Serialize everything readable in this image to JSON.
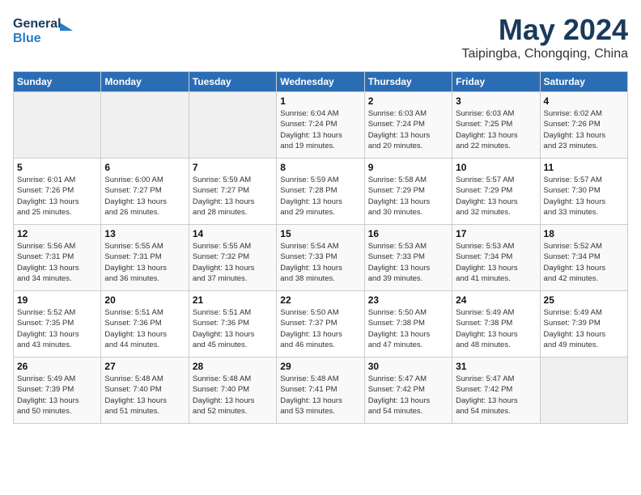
{
  "header": {
    "logo_line1": "General",
    "logo_line2": "Blue",
    "month_year": "May 2024",
    "location": "Taipingba, Chongqing, China"
  },
  "weekdays": [
    "Sunday",
    "Monday",
    "Tuesday",
    "Wednesday",
    "Thursday",
    "Friday",
    "Saturday"
  ],
  "weeks": [
    [
      {
        "day": "",
        "info": ""
      },
      {
        "day": "",
        "info": ""
      },
      {
        "day": "",
        "info": ""
      },
      {
        "day": "1",
        "info": "Sunrise: 6:04 AM\nSunset: 7:24 PM\nDaylight: 13 hours\nand 19 minutes."
      },
      {
        "day": "2",
        "info": "Sunrise: 6:03 AM\nSunset: 7:24 PM\nDaylight: 13 hours\nand 20 minutes."
      },
      {
        "day": "3",
        "info": "Sunrise: 6:03 AM\nSunset: 7:25 PM\nDaylight: 13 hours\nand 22 minutes."
      },
      {
        "day": "4",
        "info": "Sunrise: 6:02 AM\nSunset: 7:26 PM\nDaylight: 13 hours\nand 23 minutes."
      }
    ],
    [
      {
        "day": "5",
        "info": "Sunrise: 6:01 AM\nSunset: 7:26 PM\nDaylight: 13 hours\nand 25 minutes."
      },
      {
        "day": "6",
        "info": "Sunrise: 6:00 AM\nSunset: 7:27 PM\nDaylight: 13 hours\nand 26 minutes."
      },
      {
        "day": "7",
        "info": "Sunrise: 5:59 AM\nSunset: 7:27 PM\nDaylight: 13 hours\nand 28 minutes."
      },
      {
        "day": "8",
        "info": "Sunrise: 5:59 AM\nSunset: 7:28 PM\nDaylight: 13 hours\nand 29 minutes."
      },
      {
        "day": "9",
        "info": "Sunrise: 5:58 AM\nSunset: 7:29 PM\nDaylight: 13 hours\nand 30 minutes."
      },
      {
        "day": "10",
        "info": "Sunrise: 5:57 AM\nSunset: 7:29 PM\nDaylight: 13 hours\nand 32 minutes."
      },
      {
        "day": "11",
        "info": "Sunrise: 5:57 AM\nSunset: 7:30 PM\nDaylight: 13 hours\nand 33 minutes."
      }
    ],
    [
      {
        "day": "12",
        "info": "Sunrise: 5:56 AM\nSunset: 7:31 PM\nDaylight: 13 hours\nand 34 minutes."
      },
      {
        "day": "13",
        "info": "Sunrise: 5:55 AM\nSunset: 7:31 PM\nDaylight: 13 hours\nand 36 minutes."
      },
      {
        "day": "14",
        "info": "Sunrise: 5:55 AM\nSunset: 7:32 PM\nDaylight: 13 hours\nand 37 minutes."
      },
      {
        "day": "15",
        "info": "Sunrise: 5:54 AM\nSunset: 7:33 PM\nDaylight: 13 hours\nand 38 minutes."
      },
      {
        "day": "16",
        "info": "Sunrise: 5:53 AM\nSunset: 7:33 PM\nDaylight: 13 hours\nand 39 minutes."
      },
      {
        "day": "17",
        "info": "Sunrise: 5:53 AM\nSunset: 7:34 PM\nDaylight: 13 hours\nand 41 minutes."
      },
      {
        "day": "18",
        "info": "Sunrise: 5:52 AM\nSunset: 7:34 PM\nDaylight: 13 hours\nand 42 minutes."
      }
    ],
    [
      {
        "day": "19",
        "info": "Sunrise: 5:52 AM\nSunset: 7:35 PM\nDaylight: 13 hours\nand 43 minutes."
      },
      {
        "day": "20",
        "info": "Sunrise: 5:51 AM\nSunset: 7:36 PM\nDaylight: 13 hours\nand 44 minutes."
      },
      {
        "day": "21",
        "info": "Sunrise: 5:51 AM\nSunset: 7:36 PM\nDaylight: 13 hours\nand 45 minutes."
      },
      {
        "day": "22",
        "info": "Sunrise: 5:50 AM\nSunset: 7:37 PM\nDaylight: 13 hours\nand 46 minutes."
      },
      {
        "day": "23",
        "info": "Sunrise: 5:50 AM\nSunset: 7:38 PM\nDaylight: 13 hours\nand 47 minutes."
      },
      {
        "day": "24",
        "info": "Sunrise: 5:49 AM\nSunset: 7:38 PM\nDaylight: 13 hours\nand 48 minutes."
      },
      {
        "day": "25",
        "info": "Sunrise: 5:49 AM\nSunset: 7:39 PM\nDaylight: 13 hours\nand 49 minutes."
      }
    ],
    [
      {
        "day": "26",
        "info": "Sunrise: 5:49 AM\nSunset: 7:39 PM\nDaylight: 13 hours\nand 50 minutes."
      },
      {
        "day": "27",
        "info": "Sunrise: 5:48 AM\nSunset: 7:40 PM\nDaylight: 13 hours\nand 51 minutes."
      },
      {
        "day": "28",
        "info": "Sunrise: 5:48 AM\nSunset: 7:40 PM\nDaylight: 13 hours\nand 52 minutes."
      },
      {
        "day": "29",
        "info": "Sunrise: 5:48 AM\nSunset: 7:41 PM\nDaylight: 13 hours\nand 53 minutes."
      },
      {
        "day": "30",
        "info": "Sunrise: 5:47 AM\nSunset: 7:42 PM\nDaylight: 13 hours\nand 54 minutes."
      },
      {
        "day": "31",
        "info": "Sunrise: 5:47 AM\nSunset: 7:42 PM\nDaylight: 13 hours\nand 54 minutes."
      },
      {
        "day": "",
        "info": ""
      }
    ]
  ]
}
